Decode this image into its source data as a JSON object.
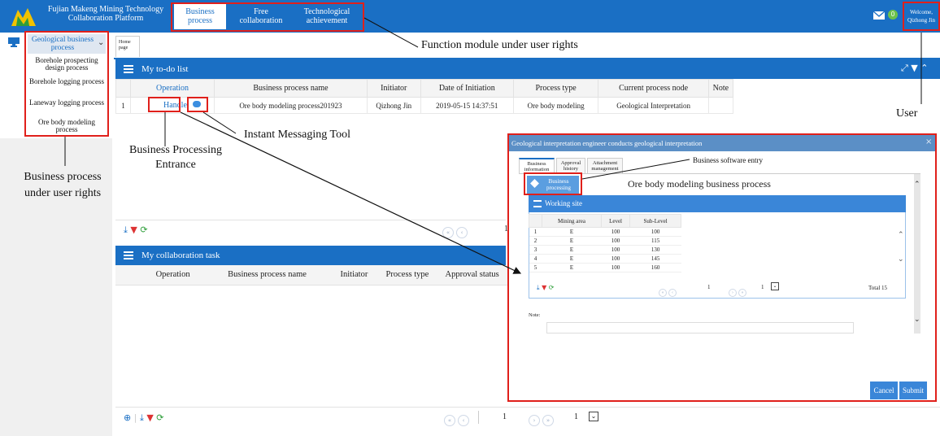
{
  "app": {
    "title": "Fujian Makeng Mining Technology Collaboration Platform"
  },
  "topnav": {
    "business": "Business process",
    "free": "Free collaboration",
    "tech": "Technological achievement"
  },
  "user": {
    "welcome": "Welcome, Qizhong Jin",
    "mail_count": "0"
  },
  "sidebar": {
    "header": "Geological business process",
    "items": [
      "Borehole prospecting design process",
      "Borehole logging process",
      "Laneway logging process",
      "Ore body modeling process"
    ]
  },
  "home_tab": "Home page",
  "todo": {
    "title": "My to-do list",
    "columns": [
      "",
      "Operation",
      "Business process name",
      "Initiator",
      "Date of Initiation",
      "Process type",
      "Current process node",
      "Note"
    ],
    "rows": [
      {
        "index": "1",
        "operation": "Handle",
        "name": "Ore body  modeling process201923",
        "initiator": "Qizhong Jin",
        "date": "2019-05-15 14:37:51",
        "type": "Ore body modeling",
        "node": "Geological Interpretation",
        "note": ""
      }
    ],
    "page": "1"
  },
  "collab": {
    "title": "My collaboration task",
    "columns": [
      "Operation",
      "Business process name",
      "Initiator",
      "Process type",
      "Approval status"
    ]
  },
  "bottom_pager": {
    "page": "1",
    "page_size_value": "1"
  },
  "dialog": {
    "title": "Geological interpretation engineer conducts geological interpretation",
    "tabs": [
      "Business information",
      "Approval history",
      "Attachment management"
    ],
    "bp_button": "Business processing",
    "working_site": {
      "title": "Working site",
      "columns": [
        "",
        "Mining area",
        "Level",
        "Sub-Level"
      ],
      "rows": [
        [
          "1",
          "E",
          "100",
          "100"
        ],
        [
          "2",
          "E",
          "100",
          "115"
        ],
        [
          "3",
          "E",
          "100",
          "130"
        ],
        [
          "4",
          "E",
          "100",
          "145"
        ],
        [
          "5",
          "E",
          "100",
          "160"
        ]
      ],
      "page": "1",
      "page_size_value": "1",
      "total": "Total 15"
    },
    "note_label": "Note:",
    "cancel": "Cancel",
    "submit": "Submit"
  },
  "annotations": {
    "function_module": "Function module under user rights",
    "user": "User",
    "instant_messaging": "Instant Messaging Tool",
    "business_entrance": "Business Processing Entrance",
    "business_under_rights": "Business process under user rights",
    "software_entry": "Business software entry",
    "ore_body": "Ore body modeling business process"
  },
  "colors": {
    "brand_blue": "#1a6fc4",
    "highlight_red": "#e0201b",
    "dialog_head": "#5b8fc6"
  }
}
